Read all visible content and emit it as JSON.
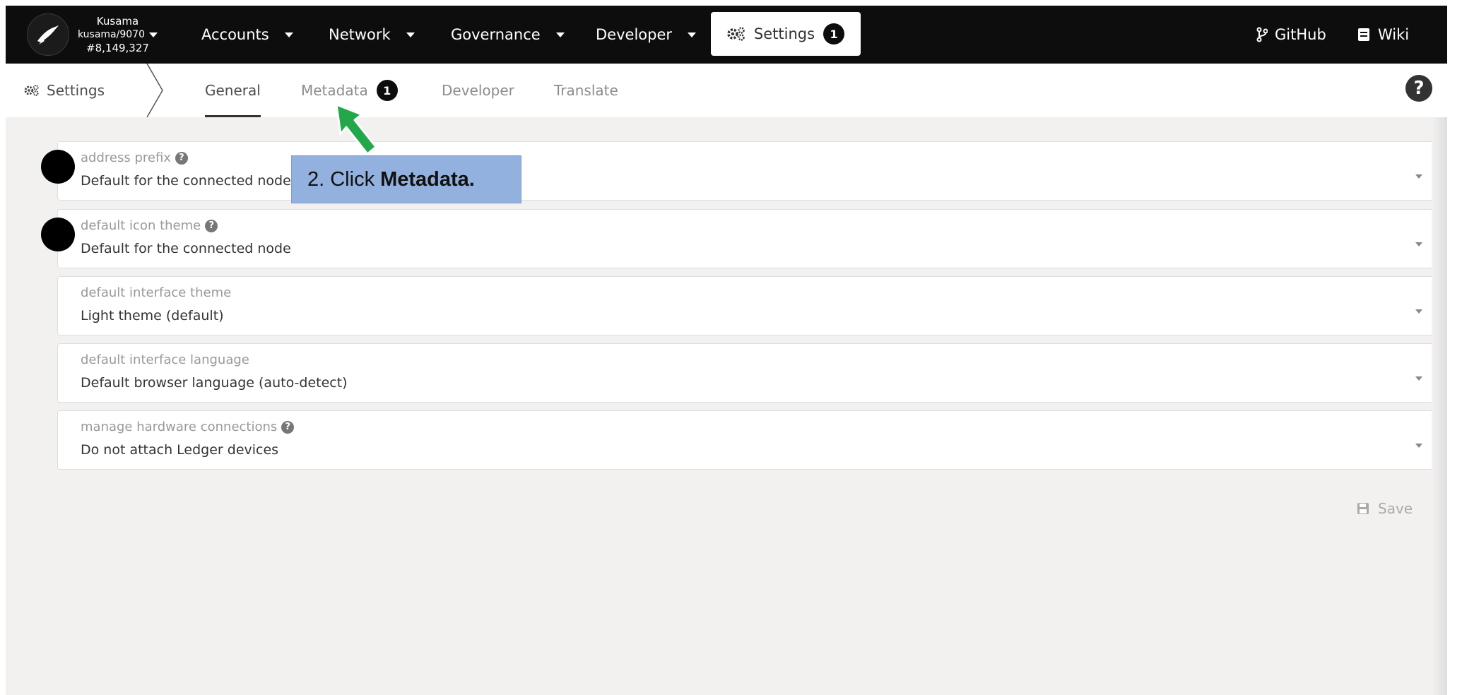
{
  "chain": {
    "name": "Kusama",
    "node": "kusama/9070",
    "block": "#8,149,327"
  },
  "nav": {
    "items": [
      {
        "label": "Accounts"
      },
      {
        "label": "Network"
      },
      {
        "label": "Governance"
      },
      {
        "label": "Developer"
      }
    ],
    "settings": {
      "label": "Settings",
      "badge": "1"
    },
    "github": "GitHub",
    "wiki": "Wiki"
  },
  "subnav": {
    "section": "Settings",
    "tabs": [
      {
        "label": "General",
        "active": true
      },
      {
        "label": "Metadata",
        "badge": "1"
      },
      {
        "label": "Developer"
      },
      {
        "label": "Translate"
      }
    ]
  },
  "settings": [
    {
      "label": "address prefix",
      "has_help": true,
      "value": "Default for the connected node"
    },
    {
      "label": "default icon theme",
      "has_help": true,
      "value": "Default for the connected node"
    },
    {
      "label": "default interface theme",
      "has_help": false,
      "value": "Light theme (default)"
    },
    {
      "label": "default interface language",
      "has_help": false,
      "value": "Default browser language (auto-detect)"
    },
    {
      "label": "manage hardware connections",
      "has_help": true,
      "value": "Do not attach Ledger devices"
    }
  ],
  "save_label": "Save",
  "annotation": {
    "prefix": "2. Click",
    "bold": "Metadata.",
    "arrow_color": "#22a84a"
  },
  "colors": {
    "topbar": "#0d0d0d",
    "background": "#f2f1f0",
    "callout": "#93b1de"
  }
}
